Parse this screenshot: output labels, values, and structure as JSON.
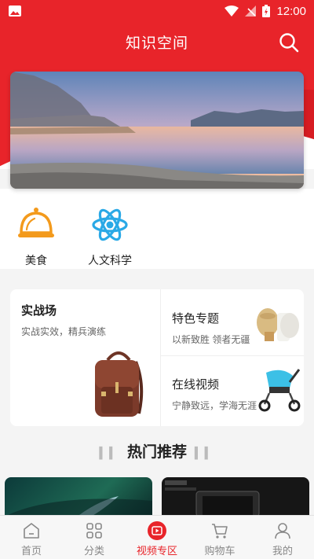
{
  "status_bar": {
    "time": "12:00"
  },
  "header": {
    "title": "知识空间"
  },
  "categories": [
    {
      "label": "美食",
      "icon": "cloche-icon"
    },
    {
      "label": "人文科学",
      "icon": "atom-icon"
    }
  ],
  "cards": {
    "left": {
      "title": "实战场",
      "subtitle": "实战实效，精兵演练"
    },
    "right_top": {
      "title": "特色专题",
      "subtitle": "以新致胜 领者无疆"
    },
    "right_bottom": {
      "title": "在线视频",
      "subtitle": "宁静致远，学海无涯"
    }
  },
  "section": {
    "title": "热门推荐"
  },
  "tabbar": {
    "items": [
      {
        "label": "首页",
        "icon": "home-icon"
      },
      {
        "label": "分类",
        "icon": "grid-icon"
      },
      {
        "label": "视频专区",
        "icon": "video-icon"
      },
      {
        "label": "购物车",
        "icon": "cart-icon"
      },
      {
        "label": "我的",
        "icon": "person-icon"
      }
    ],
    "active": "视频专区"
  },
  "colors": {
    "brand_red": "#e8242a",
    "atom_blue": "#2aa9e6",
    "cloche_orange": "#f39a1c"
  }
}
